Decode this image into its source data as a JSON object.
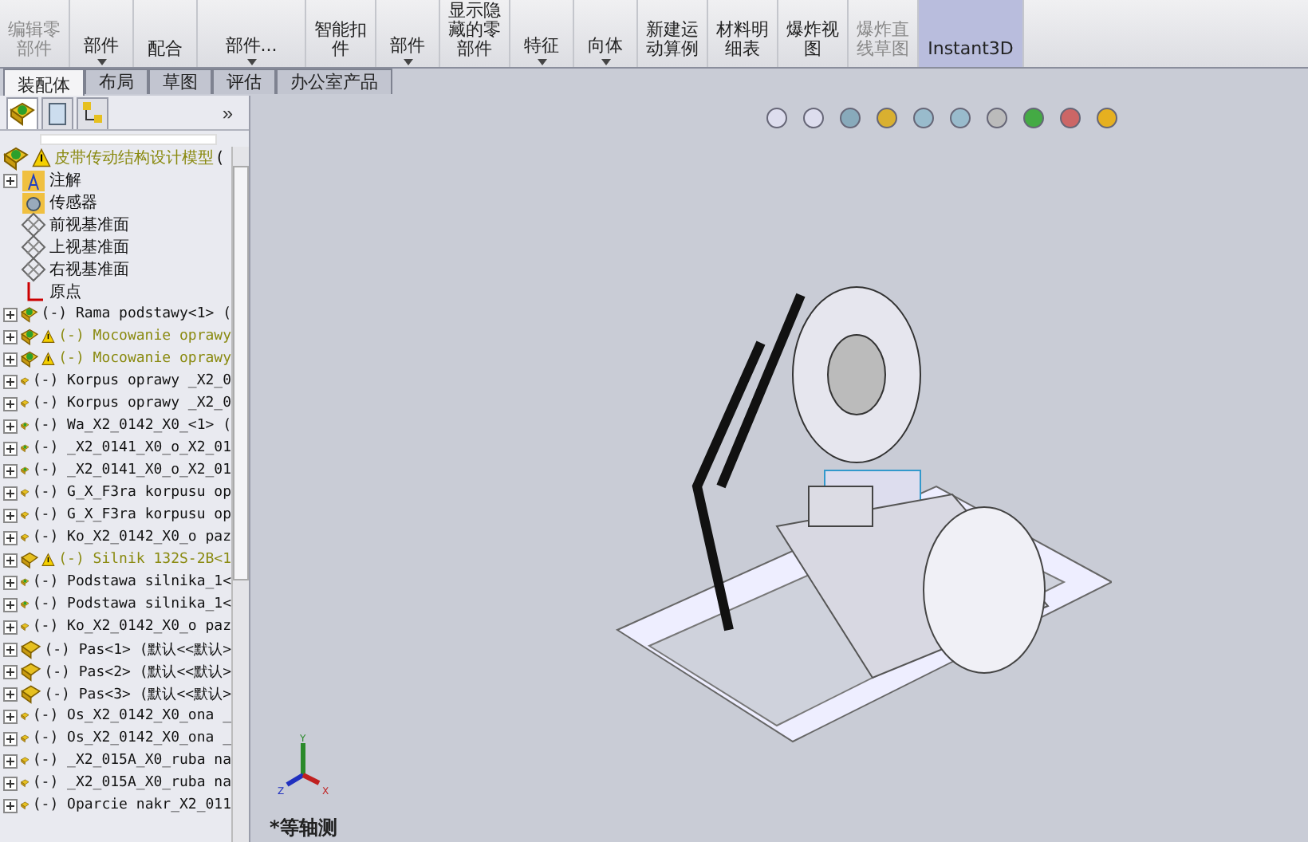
{
  "ribbon": [
    {
      "lines": [
        "编辑零",
        "部件"
      ],
      "disabled": true,
      "dropdown": false
    },
    {
      "lines": [
        "部件"
      ],
      "disabled": false,
      "dropdown": true
    },
    {
      "lines": [
        "配合"
      ],
      "disabled": false,
      "dropdown": false
    },
    {
      "lines": [
        "部件..."
      ],
      "disabled": false,
      "dropdown": true
    },
    {
      "lines": [
        "智能扣",
        "件"
      ],
      "disabled": false,
      "dropdown": false
    },
    {
      "lines": [
        "部件"
      ],
      "disabled": false,
      "dropdown": true
    },
    {
      "lines": [
        "显示隐",
        "藏的零",
        "部件"
      ],
      "disabled": false,
      "dropdown": false
    },
    {
      "lines": [
        "特征"
      ],
      "disabled": false,
      "dropdown": true
    },
    {
      "lines": [
        "向体"
      ],
      "disabled": false,
      "dropdown": true
    },
    {
      "lines": [
        "新建运",
        "动算例"
      ],
      "disabled": false,
      "dropdown": false
    },
    {
      "lines": [
        "材料明",
        "细表"
      ],
      "disabled": false,
      "dropdown": false
    },
    {
      "lines": [
        "爆炸视",
        "图"
      ],
      "disabled": false,
      "dropdown": false
    },
    {
      "lines": [
        "爆炸直",
        "线草图"
      ],
      "disabled": true,
      "dropdown": false
    },
    {
      "lines": [
        "Instant3D"
      ],
      "disabled": false,
      "dropdown": false,
      "selected": true
    }
  ],
  "tabs": [
    {
      "label": "装配体",
      "selected": true
    },
    {
      "label": "布局",
      "selected": false
    },
    {
      "label": "草图",
      "selected": false
    },
    {
      "label": "评估",
      "selected": false
    },
    {
      "label": "办公室产品",
      "selected": false
    }
  ],
  "panel_more": "»",
  "tree": {
    "root": "皮带传动结构设计模型",
    "root_suffix": "(",
    "items": [
      {
        "kind": "note",
        "label": "注解",
        "expandable": true
      },
      {
        "kind": "sensor",
        "label": "传感器",
        "expandable": false
      },
      {
        "kind": "plane",
        "label": "前视基准面",
        "expandable": false
      },
      {
        "kind": "plane",
        "label": "上视基准面",
        "expandable": false
      },
      {
        "kind": "plane",
        "label": "右视基准面",
        "expandable": false
      },
      {
        "kind": "origin",
        "label": "原点",
        "expandable": false
      },
      {
        "kind": "subassembly",
        "label": "(-) Rama podstawy<1> (",
        "warning": false
      },
      {
        "kind": "subassembly",
        "label": "(-) Mocowanie oprawy",
        "warning": true
      },
      {
        "kind": "subassembly",
        "label": "(-) Mocowanie oprawy",
        "warning": true
      },
      {
        "kind": "part",
        "label": "(-) Korpus oprawy _X2_0",
        "warning": false
      },
      {
        "kind": "part",
        "label": "(-) Korpus oprawy _X2_0",
        "warning": false
      },
      {
        "kind": "subassembly",
        "label": "(-) Wa_X2_0142_X0_<1> (",
        "warning": false
      },
      {
        "kind": "subassembly",
        "label": "(-) _X2_0141_X0_o_X2_01",
        "warning": false
      },
      {
        "kind": "subassembly",
        "label": "(-) _X2_0141_X0_o_X2_01",
        "warning": false
      },
      {
        "kind": "part",
        "label": "(-) G_X_F3ra korpusu op",
        "warning": false
      },
      {
        "kind": "part",
        "label": "(-) G_X_F3ra korpusu op",
        "warning": false
      },
      {
        "kind": "part",
        "label": "(-) Ko_X2_0142_X0_o paz",
        "warning": false
      },
      {
        "kind": "part",
        "label": "(-) Silnik 132S-2B<1",
        "warning": true
      },
      {
        "kind": "subassembly",
        "label": "(-) Podstawa silnika_1<",
        "warning": false
      },
      {
        "kind": "subassembly",
        "label": "(-) Podstawa silnika_1<",
        "warning": false
      },
      {
        "kind": "part",
        "label": "(-) Ko_X2_0142_X0_o paz",
        "warning": false
      },
      {
        "kind": "part",
        "label": "(-) Pas<1> (默认<<默认>",
        "warning": false
      },
      {
        "kind": "part",
        "label": "(-) Pas<2> (默认<<默认>",
        "warning": false
      },
      {
        "kind": "part",
        "label": "(-) Pas<3> (默认<<默认>",
        "warning": false
      },
      {
        "kind": "part",
        "label": "(-) Os_X2_0142_X0_ona _",
        "warning": false
      },
      {
        "kind": "part",
        "label": "(-) Os_X2_0142_X0_ona _",
        "warning": false
      },
      {
        "kind": "part",
        "label": "(-) _X2_015A_X0_ruba na",
        "warning": false
      },
      {
        "kind": "part",
        "label": "(-) _X2_015A_X0_ruba na",
        "warning": false
      },
      {
        "kind": "part",
        "label": "(-) Oparcie nakr_X2_011",
        "warning": false
      }
    ]
  },
  "triad": {
    "x": "X",
    "y": "Y",
    "z": "Z"
  },
  "view_name": "*等轴测"
}
